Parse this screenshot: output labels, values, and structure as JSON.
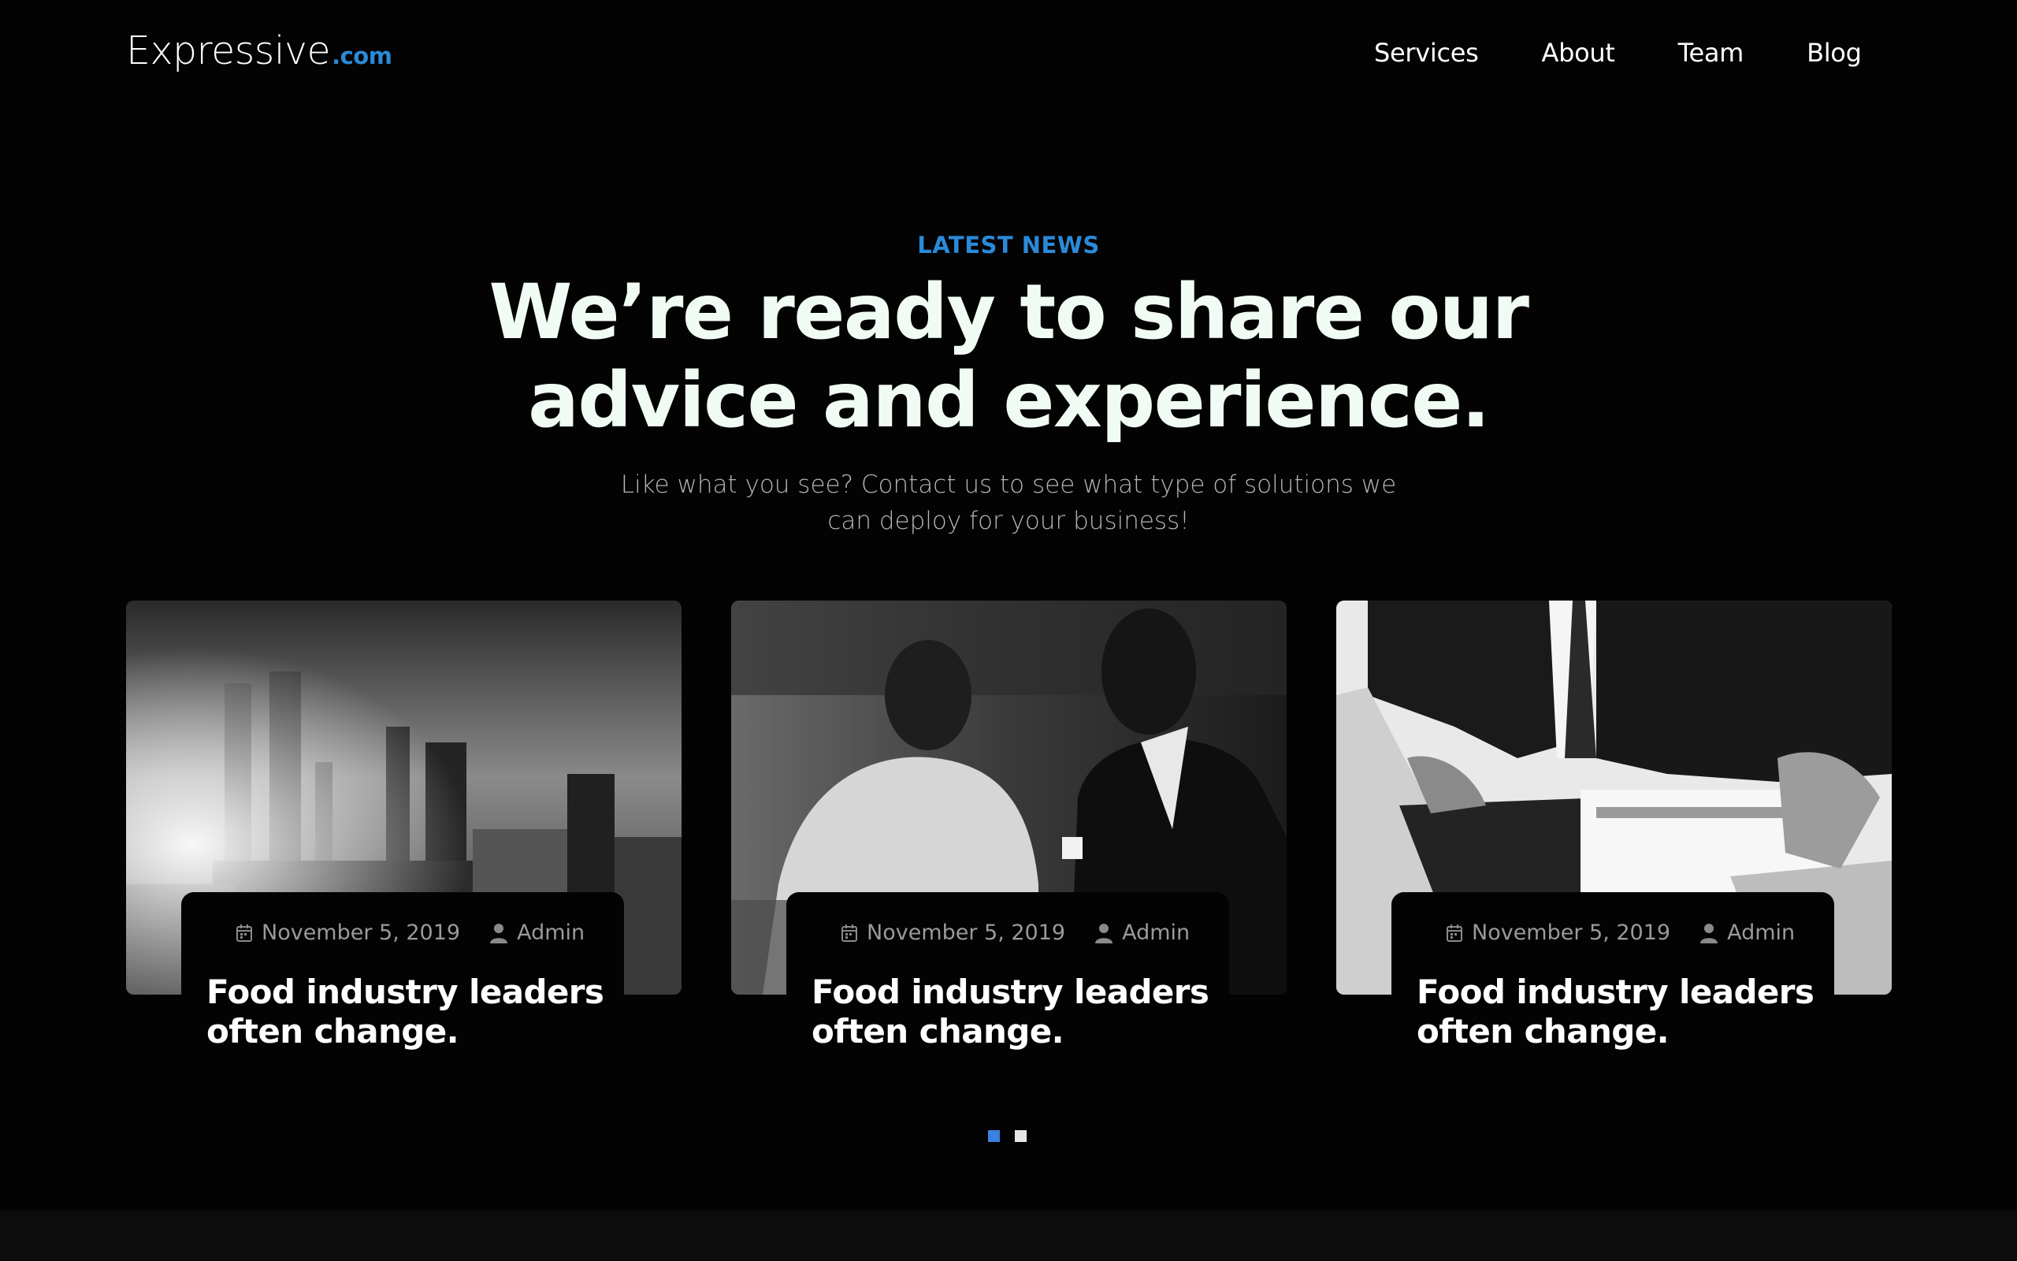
{
  "brand": {
    "name": "Expressive",
    "tld": ".com",
    "accent": "#2b8ad8"
  },
  "nav": {
    "items": [
      {
        "label": "Services"
      },
      {
        "label": "About"
      },
      {
        "label": "Team"
      },
      {
        "label": "Blog"
      }
    ]
  },
  "hero": {
    "eyebrow": "LATEST NEWS",
    "headline_line1": "We’re ready to share our",
    "headline_line2": "advice and experience.",
    "subtext_line1": "Like what you see? Contact us to see what type of solutions we",
    "subtext_line2": "can deploy for your business!"
  },
  "posts": [
    {
      "date": "November 5, 2019",
      "author": "Admin",
      "title_line1": "Food industry leaders",
      "title_line2": "often change.",
      "image": "city-skyline-photo"
    },
    {
      "date": "November 5, 2019",
      "author": "Admin",
      "title_line1": "Food industry leaders",
      "title_line2": "often change.",
      "image": "business-meeting-photo"
    },
    {
      "date": "November 5, 2019",
      "author": "Admin",
      "title_line1": "Food industry leaders",
      "title_line2": "often change.",
      "image": "laptop-calculator-photo"
    }
  ],
  "pager": {
    "active": 1,
    "count": 2,
    "active_color": "#3a82e0",
    "inactive_color": "#e6e6e6"
  }
}
